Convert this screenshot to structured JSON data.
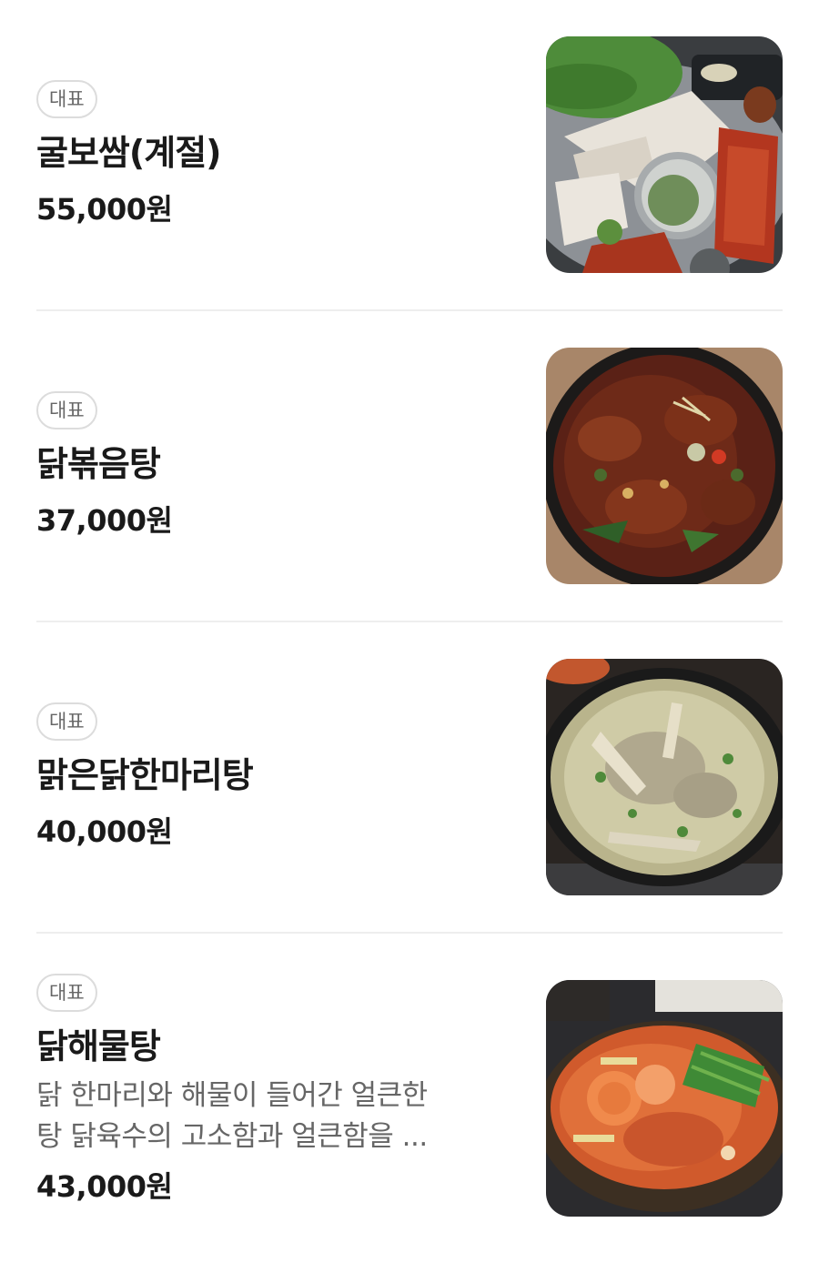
{
  "menu": {
    "items": [
      {
        "badge": "대표",
        "name": "굴보쌈(계절)",
        "description": "",
        "price": "55,000원",
        "image_icon": "bossam-dish-photo"
      },
      {
        "badge": "대표",
        "name": "닭볶음탕",
        "description": "",
        "price": "37,000원",
        "image_icon": "braised-chicken-stew-photo"
      },
      {
        "badge": "대표",
        "name": "맑은닭한마리탕",
        "description": "",
        "price": "40,000원",
        "image_icon": "clear-chicken-soup-photo"
      },
      {
        "badge": "대표",
        "name": "닭해물탕",
        "description_line1": "닭 한마리와 해물이 들어간 얼큰한",
        "description_line2": "탕 닭육수의 고소함과 얼큰함을 ...",
        "price": "43,000원",
        "image_icon": "chicken-seafood-stew-photo"
      }
    ]
  },
  "colors": {
    "badge_border": "#dcdcdc",
    "badge_text": "#666666",
    "title_text": "#1a1a1a",
    "description_text": "#666666",
    "divider": "#eeeeee"
  }
}
